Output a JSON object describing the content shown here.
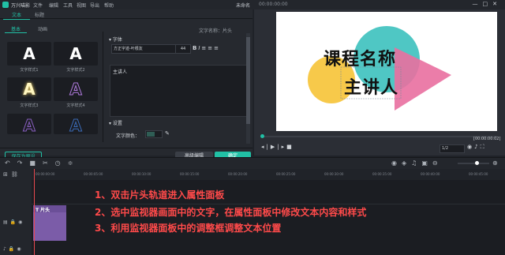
{
  "app": {
    "name": "万兴喵影",
    "menu": [
      "文件",
      "编辑",
      "工具",
      "视图",
      "导出",
      "帮助"
    ],
    "project_title": "未命名",
    "timecode": "00:00:00:00",
    "window_controls": [
      "—",
      "□",
      "✕"
    ]
  },
  "left_panel": {
    "tabs": [
      "文本",
      "标题"
    ],
    "subtabs": [
      "基本",
      "动画"
    ],
    "presets": [
      {
        "glyph": "A",
        "label": "文字样式1",
        "color": "#ffffff"
      },
      {
        "glyph": "A",
        "label": "文字样式2",
        "color": "#ffffff"
      },
      {
        "glyph": "A",
        "label": "文字样式3",
        "color": "#fff6c0"
      },
      {
        "glyph": "A",
        "label": "文字样式4",
        "color": "#9b5fcf"
      },
      {
        "glyph": "A",
        "label": "",
        "color": "#8a5fc2"
      },
      {
        "glyph": "A",
        "label": "",
        "color": "#3b6bb8"
      }
    ],
    "save_preset": "保存为预设",
    "advanced": "高级编辑",
    "ok": "确定"
  },
  "properties": {
    "section_font": "字体",
    "text_name": "文字名称：片头",
    "font_name": "方正字迹-叶根友",
    "font_size": "44",
    "text_content": "主讲人",
    "section_settings": "设置",
    "text_color_label": "文字颜色："
  },
  "monitor": {
    "title_line1": "课程名称",
    "title_line2": "主讲人",
    "time_display": "[00:00:00:02]",
    "zoom": "1/2",
    "colors": {
      "yellow": "#f7c94a",
      "teal": "#4fc7c4",
      "pink": "#e96fa0",
      "red": "#e85d6b"
    }
  },
  "timeline": {
    "ruler_marks": [
      "00:00:00:00",
      "00:00:05:00",
      "00:00:10:00",
      "00:00:15:00",
      "00:00:20:00",
      "00:00:25:00",
      "00:00:30:00",
      "00:00:35:00",
      "00:00:40:00",
      "00:00:45:00"
    ],
    "clip_label": "T 片头",
    "instructions": [
      "1、双击片头轨道进入属性面板",
      "2、选中监视器画面中的文字，在属性面板中修改文本内容和样式",
      "3、利用监视器面板中的调整框调整文本位置"
    ]
  }
}
